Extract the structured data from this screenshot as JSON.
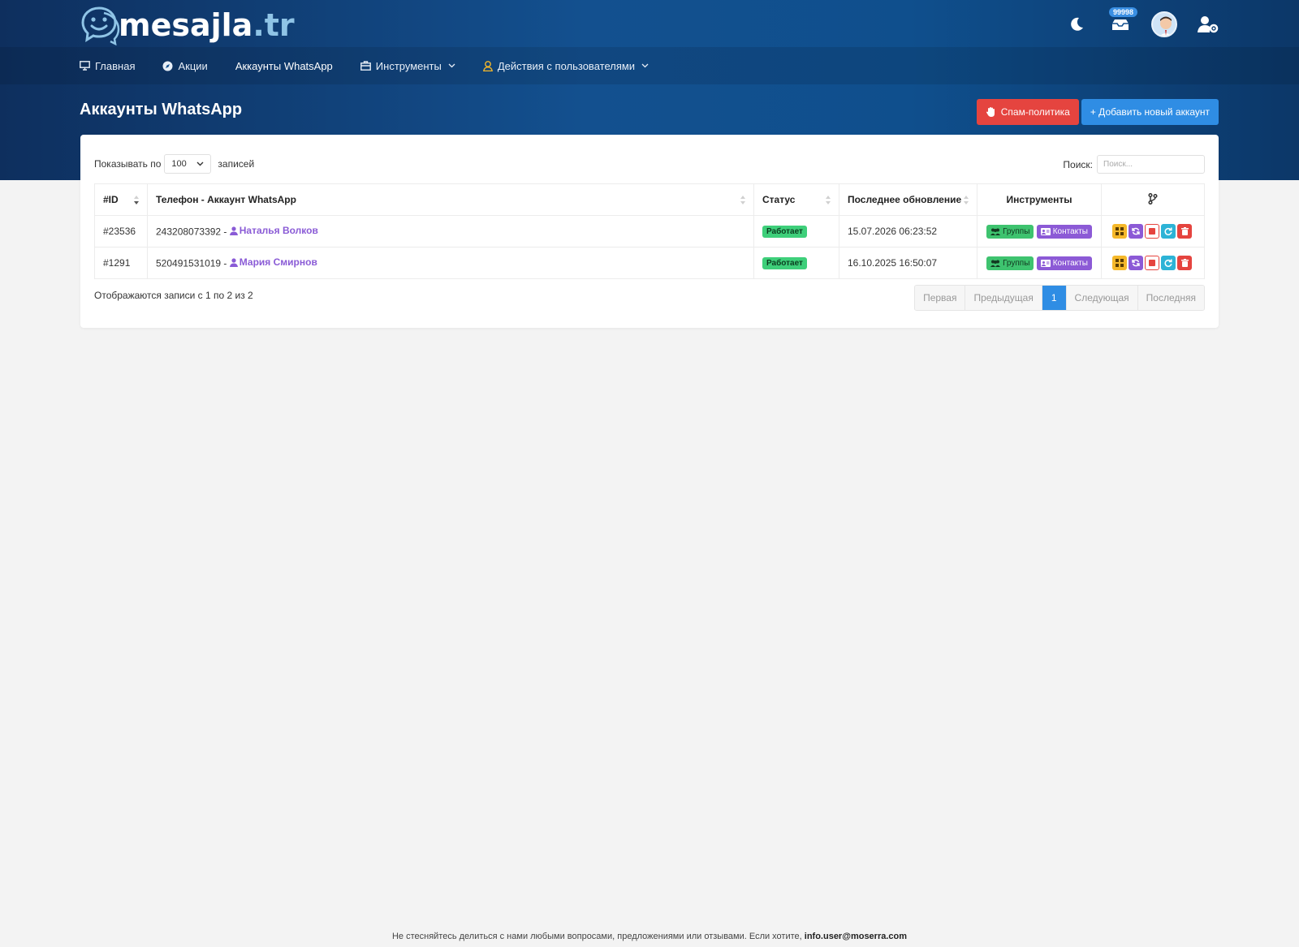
{
  "brand": {
    "name": "mesajla",
    "tld": ".tr"
  },
  "topbar": {
    "notification_count": "99998"
  },
  "nav": {
    "home": "Главная",
    "promotions": "Акции",
    "whatsapp_accounts": "Аккаунты WhatsApp",
    "tools": "Инструменты",
    "user_actions": "Действия с пользователями"
  },
  "page": {
    "title": "Аккаунты WhatsApp"
  },
  "actions": {
    "spam_policy": "Спам-политика",
    "add_account": "+ Добавить новый аккаунт"
  },
  "list": {
    "show_label": "Показывать по",
    "page_size": "100",
    "entries_label": "записей",
    "search_label": "Поиск:",
    "search_placeholder": "Поиск...",
    "headers": {
      "id": "#ID",
      "phone": "Телефон - Аккаунт WhatsApp",
      "status": "Статус",
      "updated": "Последнее обновление",
      "tools": "Инструменты"
    },
    "rows": [
      {
        "id": "#23536",
        "phone": "243208073392 - ",
        "user": "Наталья Волков",
        "status": "Работает",
        "updated": "15.07.2026 06:23:52",
        "groups": "Группы",
        "contacts": "Контакты"
      },
      {
        "id": "#1291",
        "phone": "520491531019 - ",
        "user": "Мария Смирнов",
        "status": "Работает",
        "updated": "16.10.2025 16:50:07",
        "groups": "Группы",
        "contacts": "Контакты"
      }
    ],
    "info": "Отображаются записи с 1 по 2 из 2"
  },
  "pagination": {
    "first": "Первая",
    "prev": "Предыдущая",
    "current": "1",
    "next": "Следующая",
    "last": "Последняя"
  },
  "footer": {
    "text": "Не стесняйтесь делиться с нами любыми вопросами, предложениями или отзывами. Если хотите, ",
    "email": "info.user@moserra.com"
  },
  "colors": {
    "header_bg": "#13508f",
    "red": "#e5443f",
    "blue": "#2f8de4",
    "green": "#3ecf7a",
    "purple": "#8c5ad6"
  }
}
